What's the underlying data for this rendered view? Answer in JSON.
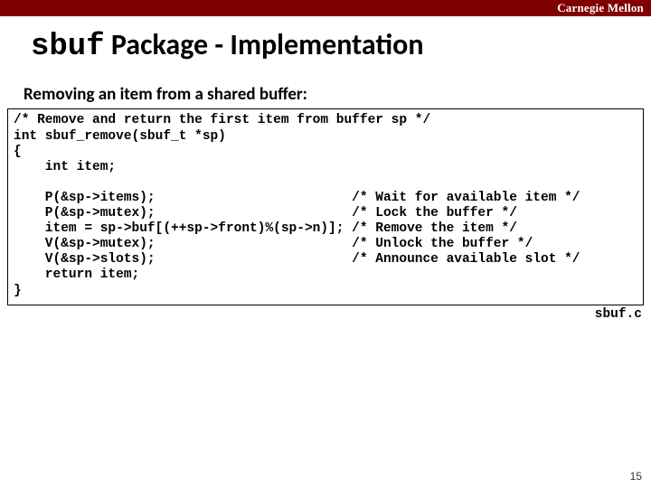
{
  "header": {
    "university": "Carnegie Mellon"
  },
  "title": {
    "mono": "sbuf",
    "rest": " Package - Implementation"
  },
  "subheading": "Removing an item from a shared buffer:",
  "code": "/* Remove and return the first item from buffer sp */\nint sbuf_remove(sbuf_t *sp)\n{\n    int item;\n\n    P(&sp->items);                         /* Wait for available item */\n    P(&sp->mutex);                         /* Lock the buffer */\n    item = sp->buf[(++sp->front)%(sp->n)]; /* Remove the item */\n    V(&sp->mutex);                         /* Unlock the buffer */\n    V(&sp->slots);                         /* Announce available slot */\n    return item;\n}",
  "filename": "sbuf.c",
  "pagenum": "15"
}
